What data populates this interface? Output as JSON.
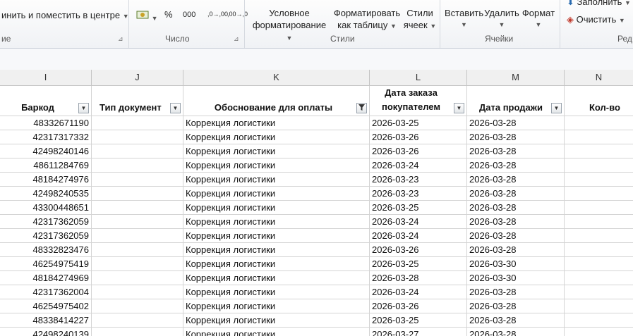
{
  "ribbon": {
    "merge_label": "инить и поместить в центре",
    "group_alignment_partial": "ие",
    "group_number": "Число",
    "percent": "%",
    "thousands": "000",
    "inc_decimal": ",0→,00",
    "dec_decimal": ",00→,0",
    "cond_format_line1": "Условное",
    "cond_format_line2": "форматирование",
    "format_table_line1": "Форматировать",
    "format_table_line2": "как таблицу",
    "cell_styles_line1": "Стили",
    "cell_styles_line2": "ячеек",
    "group_styles": "Стили",
    "insert": "Вставить",
    "delete": "Удалить",
    "format": "Формат",
    "group_cells": "Ячейки",
    "fill": "Заполнить",
    "clear": "Очистить",
    "group_editing_partial": "Ред"
  },
  "columns": [
    "I",
    "J",
    "K",
    "L",
    "M",
    "N"
  ],
  "headers": {
    "barcode": "Баркод",
    "doc_type": "Тип документ",
    "reason": "Обоснование для оплаты",
    "order_date_line1": "Дата заказа",
    "order_date_line2": "покупателем",
    "sale_date": "Дата продажи",
    "qty": "Кол-во"
  },
  "rows": [
    {
      "barcode": "48332671190",
      "reason": "Коррекция логистики",
      "order_date": "2026-03-25",
      "sale_date": "2026-03-28"
    },
    {
      "barcode": "42317317332",
      "reason": "Коррекция логистики",
      "order_date": "2026-03-26",
      "sale_date": "2026-03-28"
    },
    {
      "barcode": "42498240146",
      "reason": "Коррекция логистики",
      "order_date": "2026-03-26",
      "sale_date": "2026-03-28"
    },
    {
      "barcode": "48611284769",
      "reason": "Коррекция логистики",
      "order_date": "2026-03-24",
      "sale_date": "2026-03-28"
    },
    {
      "barcode": "48184274976",
      "reason": "Коррекция логистики",
      "order_date": "2026-03-23",
      "sale_date": "2026-03-28"
    },
    {
      "barcode": "42498240535",
      "reason": "Коррекция логистики",
      "order_date": "2026-03-23",
      "sale_date": "2026-03-28"
    },
    {
      "barcode": "43300448651",
      "reason": "Коррекция логистики",
      "order_date": "2026-03-25",
      "sale_date": "2026-03-28"
    },
    {
      "barcode": "42317362059",
      "reason": "Коррекция логистики",
      "order_date": "2026-03-24",
      "sale_date": "2026-03-28"
    },
    {
      "barcode": "42317362059",
      "reason": "Коррекция логистики",
      "order_date": "2026-03-24",
      "sale_date": "2026-03-28"
    },
    {
      "barcode": "48332823476",
      "reason": "Коррекция логистики",
      "order_date": "2026-03-26",
      "sale_date": "2026-03-28"
    },
    {
      "barcode": "46254975419",
      "reason": "Коррекция логистики",
      "order_date": "2026-03-25",
      "sale_date": "2026-03-30"
    },
    {
      "barcode": "48184274969",
      "reason": "Коррекция логистики",
      "order_date": "2026-03-28",
      "sale_date": "2026-03-30"
    },
    {
      "barcode": "42317362004",
      "reason": "Коррекция логистики",
      "order_date": "2026-03-24",
      "sale_date": "2026-03-28"
    },
    {
      "barcode": "46254975402",
      "reason": "Коррекция логистики",
      "order_date": "2026-03-26",
      "sale_date": "2026-03-28"
    },
    {
      "barcode": "48338414227",
      "reason": "Коррекция логистики",
      "order_date": "2026-03-25",
      "sale_date": "2026-03-28"
    },
    {
      "barcode": "42498240139",
      "reason": "Коррекция логистики",
      "order_date": "2026-03-27",
      "sale_date": "2026-03-28"
    }
  ]
}
